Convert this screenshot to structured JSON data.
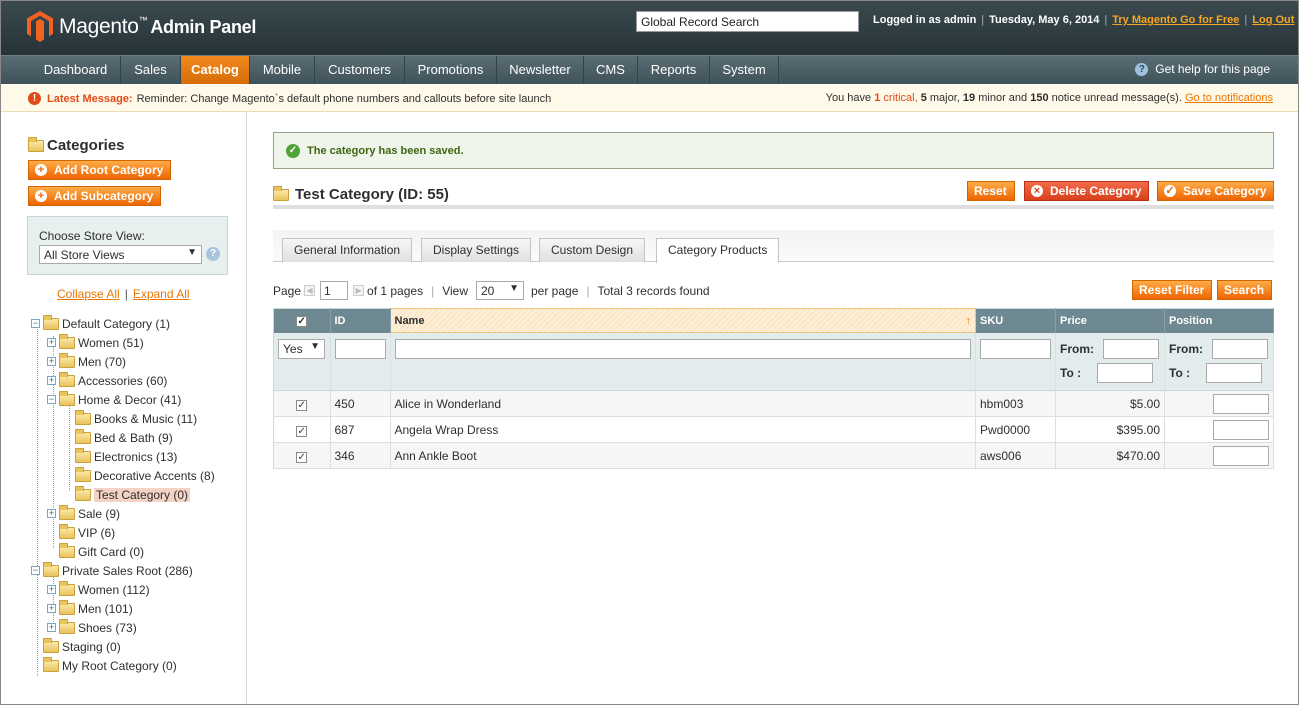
{
  "header": {
    "brand": "Magento",
    "brand_suffix": "Admin Panel",
    "search_placeholder": "Global Record Search",
    "logged_in": "Logged in as admin",
    "date": "Tuesday, May 6, 2014",
    "try_link": "Try Magento Go for Free",
    "logout": "Log Out"
  },
  "nav": {
    "items": [
      "Dashboard",
      "Sales",
      "Catalog",
      "Mobile",
      "Customers",
      "Promotions",
      "Newsletter",
      "CMS",
      "Reports",
      "System"
    ],
    "active": "Catalog",
    "help": "Get help for this page"
  },
  "message": {
    "label": "Latest Message:",
    "text": "Reminder: Change Magento`s default phone numbers and callouts before site launch",
    "you_have": "You have",
    "critical_n": "1",
    "critical": "critical,",
    "major_n": "5",
    "major": "major,",
    "minor_n": "19",
    "minor": "minor and",
    "notice_n": "150",
    "notice": "notice unread message(s).",
    "goto": "Go to notifications"
  },
  "sidebar": {
    "title": "Categories",
    "add_root": "Add Root Category",
    "add_sub": "Add Subcategory",
    "store_label": "Choose Store View:",
    "store_value": "All Store Views",
    "collapse_all": "Collapse All",
    "expand_all": "Expand All",
    "tree": [
      "Default Category (1)",
      "Women (51)",
      "Men (70)",
      "Accessories (60)",
      "Home & Decor (41)",
      "Books & Music (11)",
      "Bed & Bath (9)",
      "Electronics (13)",
      "Decorative Accents (8)",
      "Test Category (0)",
      "Sale (9)",
      "VIP (6)",
      "Gift Card (0)",
      "Private Sales Root (286)",
      "Women (112)",
      "Men (101)",
      "Shoes (73)",
      "Staging (0)",
      "My Root Category (0)"
    ]
  },
  "main": {
    "success": "The category has been saved.",
    "title": "Test Category (ID: 55)",
    "reset": "Reset",
    "delete": "Delete Category",
    "save": "Save Category",
    "tabs": [
      "General Information",
      "Display Settings",
      "Custom Design",
      "Category Products"
    ],
    "pager": {
      "page_label": "Page",
      "page_value": "1",
      "of_pages": "of 1 pages",
      "view_label": "View",
      "view_value": "20",
      "per_page": "per page",
      "total": "Total 3 records found",
      "reset_filter": "Reset Filter",
      "search": "Search"
    },
    "columns": [
      "ID",
      "Name",
      "SKU",
      "Price",
      "Position"
    ],
    "filter_yes": "Yes",
    "from": "From:",
    "to": "To :",
    "rows": [
      {
        "id": "450",
        "name": "Alice in Wonderland",
        "sku": "hbm003",
        "price": "$5.00"
      },
      {
        "id": "687",
        "name": "Angela Wrap Dress",
        "sku": "Pwd0000",
        "price": "$395.00"
      },
      {
        "id": "346",
        "name": "Ann Ankle Boot",
        "sku": "aws006",
        "price": "$470.00"
      }
    ]
  },
  "colors": {
    "accent": "#eb6a04",
    "header": "#2d3b41",
    "nav": "#4c5f66"
  }
}
